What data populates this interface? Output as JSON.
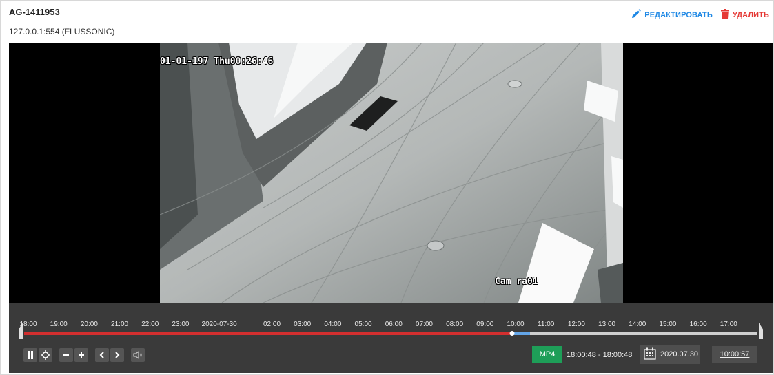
{
  "camera": {
    "title": "AG-1411953",
    "url": "127.0.0.1:554 (FLUSSONIC)"
  },
  "actions": {
    "edit_label": "РЕДАКТИРОВАТЬ",
    "delete_label": "УДАЛИТЬ",
    "edit_color": "#1e88e5",
    "delete_color": "#e53935"
  },
  "video": {
    "osd_timestamp": "01-01-197 Thu00:26:46",
    "osd_camera_name": "Cam ra01"
  },
  "timeline": {
    "ticks": [
      "18:00",
      "19:00",
      "20:00",
      "21:00",
      "22:00",
      "23:00",
      "2020-07-30",
      "02:00",
      "03:00",
      "04:00",
      "05:00",
      "06:00",
      "07:00",
      "08:00",
      "09:00",
      "10:00",
      "11:00",
      "12:00",
      "13:00",
      "14:00",
      "15:00",
      "16:00",
      "17:00"
    ],
    "recorded_fraction": 0.665,
    "buffer_fraction": 0.025,
    "colors": {
      "recorded": "#d32f2f",
      "buffer": "#64a6e8",
      "track": "#cfcfcf"
    }
  },
  "controls": {
    "icons": [
      "pause-icon",
      "center-target-icon",
      "zoom-out-icon",
      "zoom-in-icon",
      "prev-icon",
      "next-icon",
      "mute-icon",
      "calendar-icon"
    ],
    "format_label": "MP4",
    "format_color": "#1e9e58",
    "time_range": "18:00:48 - 18:00:48",
    "date": "2020.07.30",
    "current_time": "10:00:57"
  }
}
